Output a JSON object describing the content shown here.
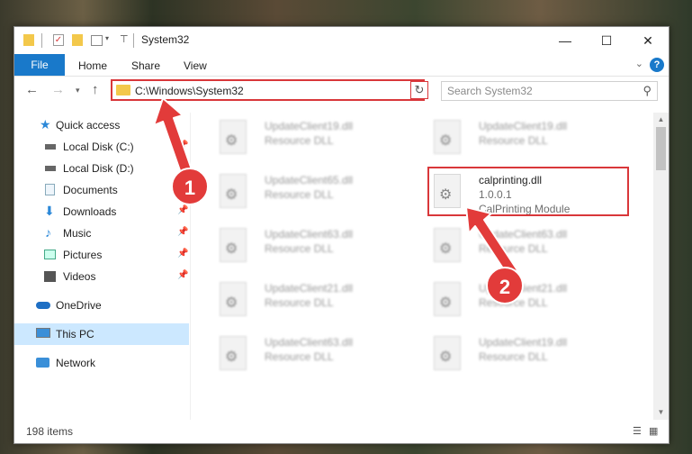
{
  "window": {
    "title": "System32"
  },
  "window_controls": {
    "minimize": "—",
    "maximize": "☐",
    "close": "✕"
  },
  "ribbon": {
    "file": "File",
    "tabs": [
      "Home",
      "Share",
      "View"
    ]
  },
  "address": {
    "path": "C:\\Windows\\System32",
    "search_placeholder": "Search System32"
  },
  "nav_pane": {
    "items": [
      {
        "label": "Quick access",
        "icon": "star-icon",
        "pinned": false
      },
      {
        "label": "Local Disk (C:)",
        "icon": "drive-icon",
        "pinned": true
      },
      {
        "label": "Local Disk (D:)",
        "icon": "drive-icon",
        "pinned": false
      },
      {
        "label": "Documents",
        "icon": "documents-icon",
        "pinned": true
      },
      {
        "label": "Downloads",
        "icon": "download-icon",
        "pinned": true
      },
      {
        "label": "Music",
        "icon": "music-icon",
        "pinned": true
      },
      {
        "label": "Pictures",
        "icon": "pictures-icon",
        "pinned": true
      },
      {
        "label": "Videos",
        "icon": "videos-icon",
        "pinned": true
      },
      {
        "label": "OneDrive",
        "icon": "cloud-icon",
        "pinned": false
      },
      {
        "label": "This PC",
        "icon": "pc-icon",
        "pinned": false
      },
      {
        "label": "Network",
        "icon": "network-icon",
        "pinned": false
      }
    ]
  },
  "files": {
    "left": [
      {
        "name": "UpdateClient19.dll",
        "type": "Resource DLL"
      },
      {
        "name": "UpdateClient65.dll",
        "type": "Resource DLL"
      },
      {
        "name": "UpdateClient63.dll",
        "type": "Resource DLL"
      },
      {
        "name": "UpdateClient21.dll",
        "type": "Resource DLL"
      },
      {
        "name": "UpdateClient63.dll",
        "type": "Resource DLL"
      }
    ],
    "right": [
      {
        "name": "UpdateClient19.dll",
        "type": "Resource DLL"
      },
      {
        "name": "calprinting.dll",
        "version": "1.0.0.1",
        "type": "CalPrinting Module"
      },
      {
        "name": "UpdateClient63.dll",
        "type": "Resource DLL"
      },
      {
        "name": "UpdateClient21.dll",
        "type": "Resource DLL"
      },
      {
        "name": "UpdateClient19.dll",
        "type": "Resource DLL"
      }
    ]
  },
  "status": {
    "count": "198 items"
  },
  "annotations": {
    "step1": "1",
    "step2": "2",
    "accent": "#e23b3a"
  }
}
